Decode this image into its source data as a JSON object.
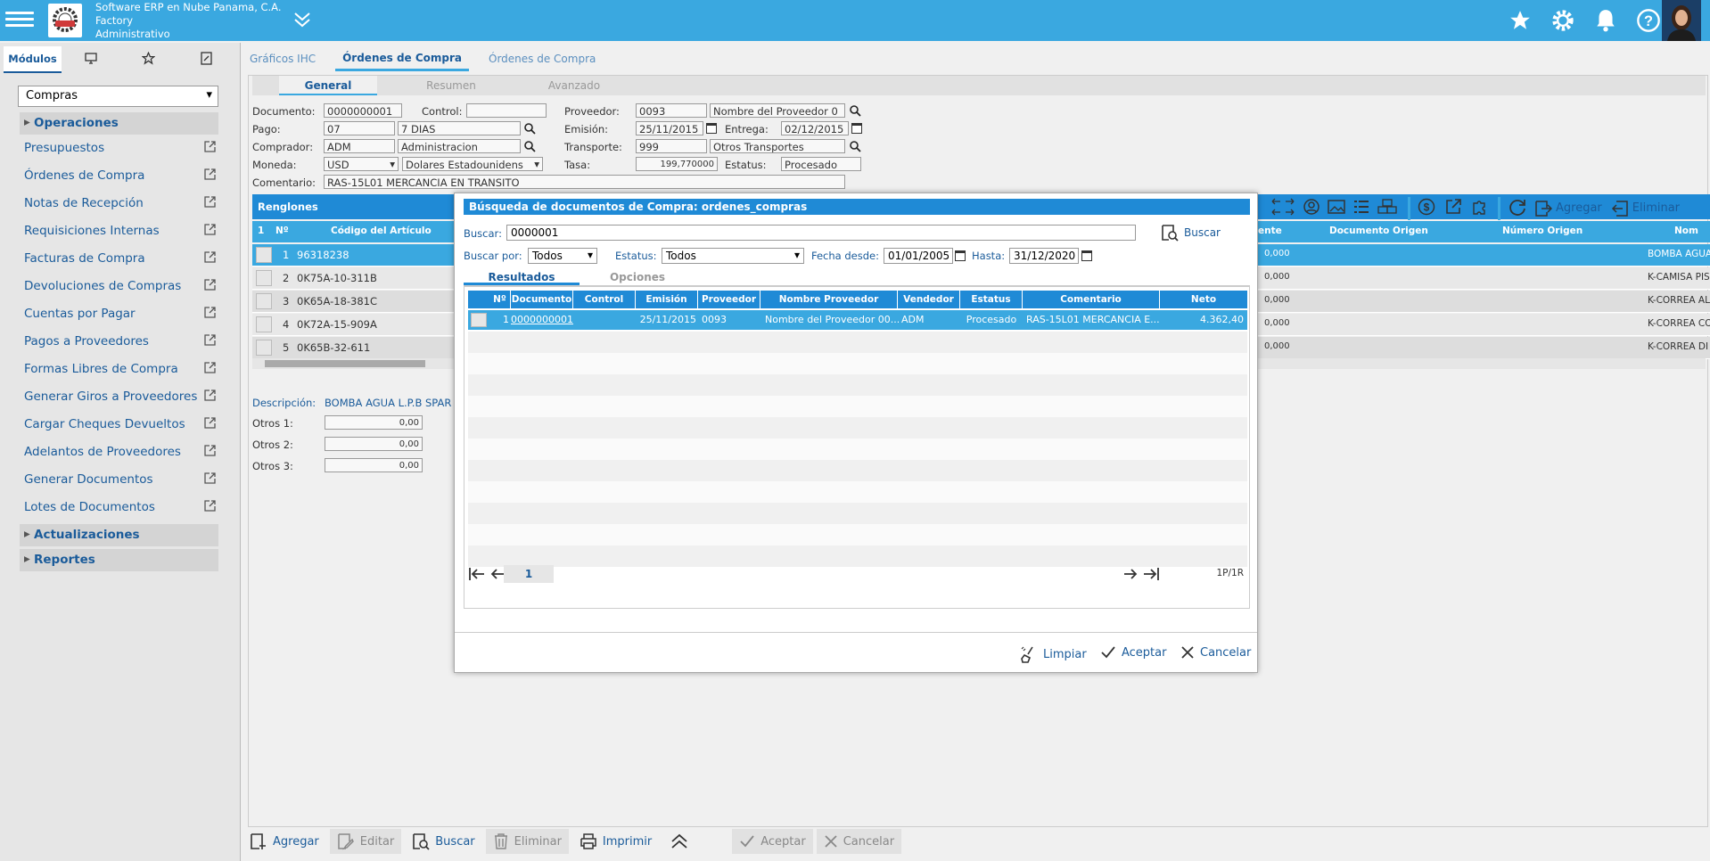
{
  "app": {
    "company": "Software ERP en Nube Panama, C.A.",
    "module": "Factory",
    "role": "Administrativo"
  },
  "top_icons": [
    "star-icon",
    "gear-icon",
    "bell-icon",
    "help-icon"
  ],
  "sidebar": {
    "tabs": [
      "Módulos",
      "",
      "",
      ""
    ],
    "select": "Compras",
    "sections": [
      "Operaciones",
      "Actualizaciones",
      "Reportes"
    ],
    "items": [
      "Presupuestos",
      "Órdenes de Compra",
      "Notas de Recepción",
      "Requisiciones Internas",
      "Facturas de Compra",
      "Devoluciones de Compras",
      "Cuentas por Pagar",
      "Pagos a Proveedores",
      "Formas Libres de Compra",
      "Generar Giros a Proveedores",
      "Cargar Cheques Devueltos",
      "Adelantos de Proveedores",
      "Generar Documentos",
      "Lotes de Documentos"
    ]
  },
  "main": {
    "tabs": [
      "Gráficos IHC",
      "Órdenes de Compra",
      "Órdenes de Compra"
    ],
    "subtabs": [
      "General",
      "Resumen",
      "Avanzado"
    ],
    "form": {
      "documento_label": "Documento:",
      "documento": "0000000001",
      "control_label": "Control:",
      "control": "",
      "proveedor_label": "Proveedor:",
      "proveedor_code": "0093",
      "proveedor_name": "Nombre del Proveedor 0",
      "pago_label": "Pago:",
      "pago_code": "07",
      "pago_name": "7 DIAS",
      "emision_label": "Emisión:",
      "emision": "25/11/2015",
      "entrega_label": "Entrega:",
      "entrega": "02/12/2015",
      "comprador_label": "Comprador:",
      "comprador_code": "ADM",
      "comprador_name": "Administracion",
      "transporte_label": "Transporte:",
      "transporte_code": "999",
      "transporte_name": "Otros Transportes",
      "moneda_label": "Moneda:",
      "moneda_code": "USD",
      "moneda_name": "Dolares Estadounidens",
      "tasa_label": "Tasa:",
      "tasa": "199,770000",
      "estatus_label": "Estatus:",
      "estatus": "Procesado",
      "comentario_label": "Comentario:",
      "comentario": "RAS-15L01  MERCANCIA EN TRANSITO"
    },
    "grid": {
      "title": "Renglones",
      "cols": [
        "1",
        "Nº",
        "Código del Artículo",
        "ente",
        "Documento Origen",
        "Número Origen",
        "Nom"
      ],
      "rows": [
        {
          "n": "1",
          "code": "96318238",
          "val": "0,000",
          "name": "BOMBA AGUA"
        },
        {
          "n": "2",
          "code": "0K75A-10-311B",
          "val": "0,000",
          "name": "K-CAMISA PIS"
        },
        {
          "n": "3",
          "code": "0K65A-18-381C",
          "val": "0,000",
          "name": "K-CORREA AL"
        },
        {
          "n": "4",
          "code": "0K72A-15-909A",
          "val": "0,000",
          "name": "K-CORREA CO"
        },
        {
          "n": "5",
          "code": "0K65B-32-611",
          "val": "0,000",
          "name": "K-CORREA DI"
        }
      ],
      "agregar": "Agregar",
      "eliminar": "Eliminar"
    },
    "descripcion_label": "Descripción:",
    "descripcion": "BOMBA AGUA L.P.B SPAR",
    "otros": [
      {
        "label": "Otros 1:",
        "value": "0,00"
      },
      {
        "label": "Otros 2:",
        "value": "0,00"
      },
      {
        "label": "Otros 3:",
        "value": "0,00"
      }
    ]
  },
  "bottom_bar": {
    "agregar": "Agregar",
    "editar": "Editar",
    "buscar": "Buscar",
    "eliminar": "Eliminar",
    "imprimir": "Imprimir",
    "aceptar": "Aceptar",
    "cancelar": "Cancelar"
  },
  "dialog": {
    "title": "Búsqueda de documentos de Compra: ordenes_compras",
    "buscar_label": "Buscar:",
    "buscar_value": "0000001",
    "buscar_btn": "Buscar",
    "buscar_por_label": "Buscar por:",
    "buscar_por": "Todos",
    "estatus_label": "Estatus:",
    "estatus": "Todos",
    "fecha_desde_label": "Fecha desde:",
    "fecha_desde": "01/01/2005",
    "hasta_label": "Hasta:",
    "hasta": "31/12/2020",
    "tabs": [
      "Resultados",
      "Opciones"
    ],
    "cols": [
      "Nº",
      "Documento",
      "Control",
      "Emisión",
      "Proveedor",
      "Nombre Proveedor",
      "Vendedor",
      "Estatus",
      "Comentario",
      "Neto"
    ],
    "row": {
      "n": "1",
      "documento": "0000000001",
      "control": "",
      "emision": "25/11/2015",
      "proveedor": "0093",
      "nombre": "Nombre del Proveedor 00...",
      "vendedor": "ADM",
      "estatus": "Procesado",
      "comentario": "RAS-15L01 MERCANCIA E...",
      "neto": "4.362,40"
    },
    "page": "1",
    "page_info": "1P/1R",
    "limpiar": "Limpiar",
    "aceptar": "Aceptar",
    "cancelar": "Cancelar"
  }
}
